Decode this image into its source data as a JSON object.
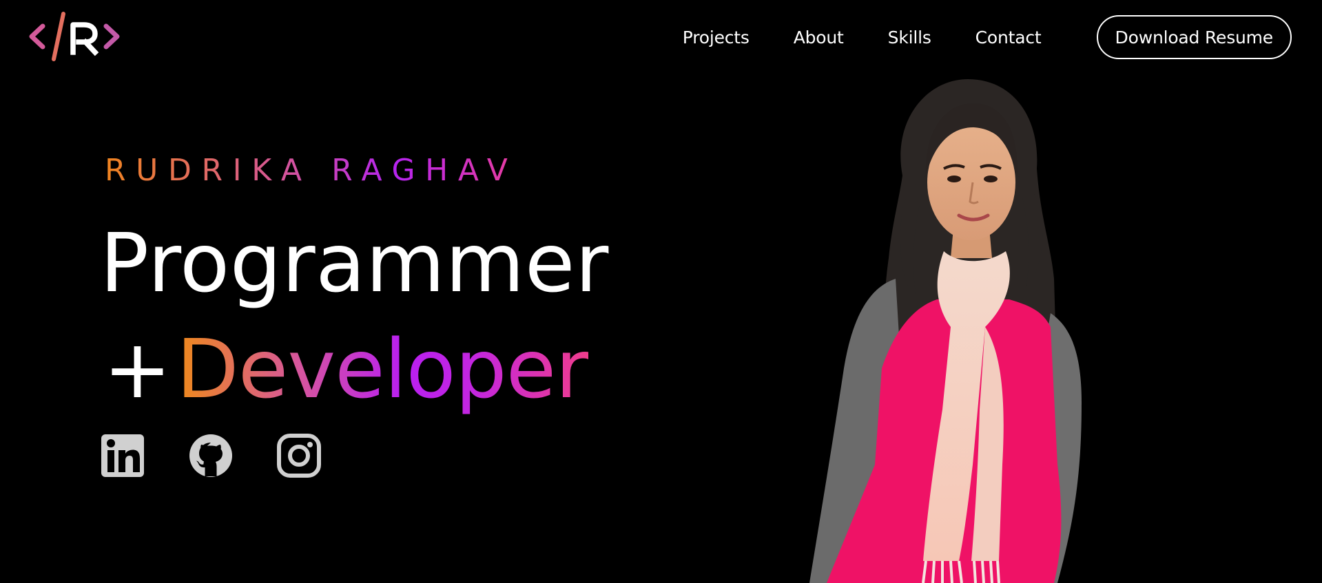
{
  "logo": {
    "text": "</R>",
    "colors": {
      "bracket": "#d45a9a",
      "slash": "#e46f5f",
      "letter": "#ffffff"
    }
  },
  "nav": {
    "links": [
      "Projects",
      "About",
      "Skills",
      "Contact"
    ],
    "resume_button": "Download Resume"
  },
  "hero": {
    "name": "RUDRIKA RAGHAV",
    "title": "Programmer",
    "plus": "+",
    "subtitle": "Developer"
  },
  "social": {
    "icons": [
      "linkedin-icon",
      "github-icon",
      "instagram-icon"
    ],
    "icon_color": "#d0d0d0"
  },
  "colors": {
    "background": "#000000",
    "text": "#ffffff",
    "gradient": [
      "#f0841f",
      "#d4539f",
      "#b524f0",
      "#e93d9f"
    ]
  }
}
